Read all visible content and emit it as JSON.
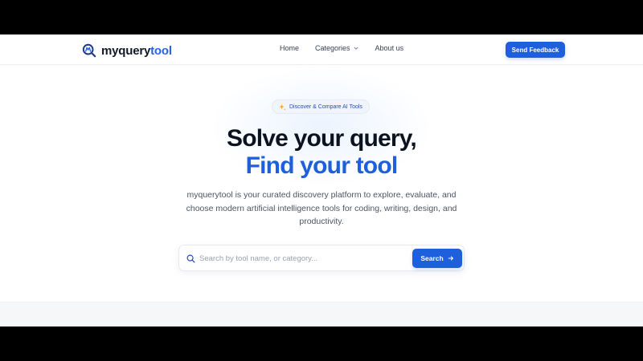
{
  "brand": {
    "name_part1": "myquery",
    "name_part2": "tool",
    "accent_color": "#2563eb"
  },
  "nav": {
    "items": [
      {
        "label": "Home"
      },
      {
        "label": "Categories"
      },
      {
        "label": "About us"
      }
    ],
    "feedback_label": "Send Feedback"
  },
  "hero": {
    "badge": "Discover & Compare AI Tools",
    "title_line1": "Solve your query,",
    "title_line2": "Find your tool",
    "description": "myquerytool is your curated discovery platform to explore, evaluate, and choose modern artificial intelligence tools for coding, writing, design, and productivity."
  },
  "search": {
    "placeholder": "Search by tool name, or category...",
    "button_label": "Search"
  },
  "icons": {
    "logo": "magnifier-logo-icon",
    "categories_dropdown": "chevron-down-icon",
    "badge": "sparkle-icon",
    "search": "search-icon",
    "search_button": "arrow-right-icon"
  }
}
